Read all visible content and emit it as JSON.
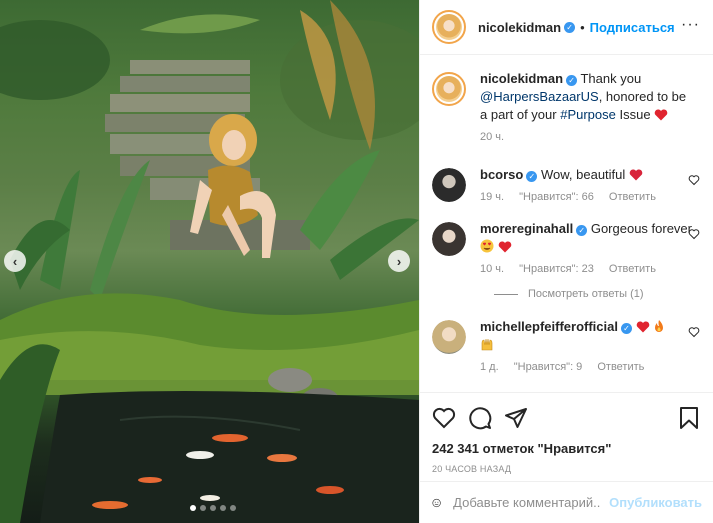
{
  "post": {
    "author": "nicolekidman",
    "follow_label": "Подписаться",
    "separator": "•"
  },
  "caption": {
    "author": "nicolekidman",
    "text_before": "Thank you ",
    "mention": "@HarpersBazaarUS",
    "text_middle": ", honored to be a part of your ",
    "hashtag": "#Purpose",
    "text_after": " Issue",
    "time": "20 ч."
  },
  "comments": [
    {
      "author": "bcorso",
      "text": "Wow, beautiful",
      "time": "19 ч.",
      "likes": "\"Нравится\": 66",
      "reply": "Ответить"
    },
    {
      "author": "morereginahall",
      "text": "Gorgeous forever",
      "time": "10 ч.",
      "likes": "\"Нравится\": 23",
      "reply": "Ответить"
    },
    {
      "author": "michellepfeifferofficial",
      "text": "",
      "time": "1 д.",
      "likes": "\"Нравится\": 9",
      "reply": "Ответить"
    }
  ],
  "view_replies": "Посмотреть ответы (1)",
  "likes_text": "242 341 отметок \"Нравится\"",
  "post_time": "20 ЧАСОВ НАЗАД",
  "add_comment": {
    "placeholder": "Добавьте комментарий...",
    "publish": "Опубликовать"
  },
  "carousel": {
    "dots": 5,
    "active_index": 0
  },
  "icons": [
    "chevron-left-icon",
    "chevron-right-icon",
    "more-options-icon",
    "verified-icon",
    "heart-icon",
    "comment-icon",
    "share-icon",
    "bookmark-icon",
    "emoji-icon"
  ],
  "colors": {
    "link": "#00376b",
    "accent": "#0095f6",
    "verified": "#3897f0",
    "heart": "#ed4956"
  }
}
